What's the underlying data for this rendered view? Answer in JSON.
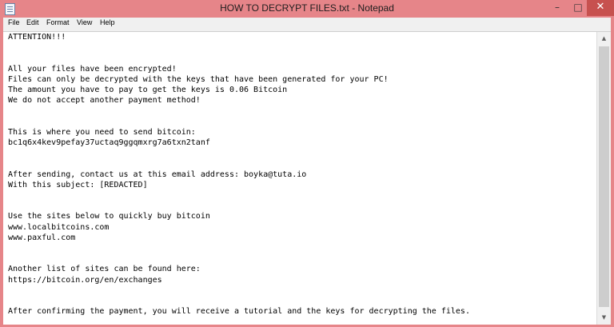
{
  "window": {
    "title": "HOW TO DECRYPT FILES.txt - Notepad",
    "controls": {
      "minimize": "–",
      "maximize": "□",
      "close": "✕"
    }
  },
  "menu": [
    "File",
    "Edit",
    "Format",
    "View",
    "Help"
  ],
  "document": {
    "lines": [
      "ATTENTION!!!",
      "",
      "",
      "All your files have been encrypted!",
      "Files can only be decrypted with the keys that have been generated for your PC!",
      "The amount you have to pay to get the keys is 0.06 Bitcoin",
      "We do not accept another payment method!",
      "",
      "",
      "This is where you need to send bitcoin:",
      "bc1q6x4kev9pefay37uctaq9ggqmxrg7a6txn2tanf",
      "",
      "",
      "After sending, contact us at this email address: boyka@tuta.io",
      "With this subject: [REDACTED]",
      "",
      "",
      "Use the sites below to quickly buy bitcoin",
      "www.localbitcoins.com",
      "www.paxful.com",
      "",
      "",
      "Another list of sites can be found here:",
      "https://bitcoin.org/en/exchanges",
      "",
      "",
      "After confirming the payment, you will receive a tutorial and the keys for decrypting the files."
    ]
  },
  "scrollbar": {
    "up_arrow": "▲",
    "down_arrow": "▼"
  },
  "colors": {
    "frame": "#e68589",
    "close_button": "#c7514f",
    "menu_bg": "#f0f0f0",
    "editor_bg": "#ffffff"
  }
}
